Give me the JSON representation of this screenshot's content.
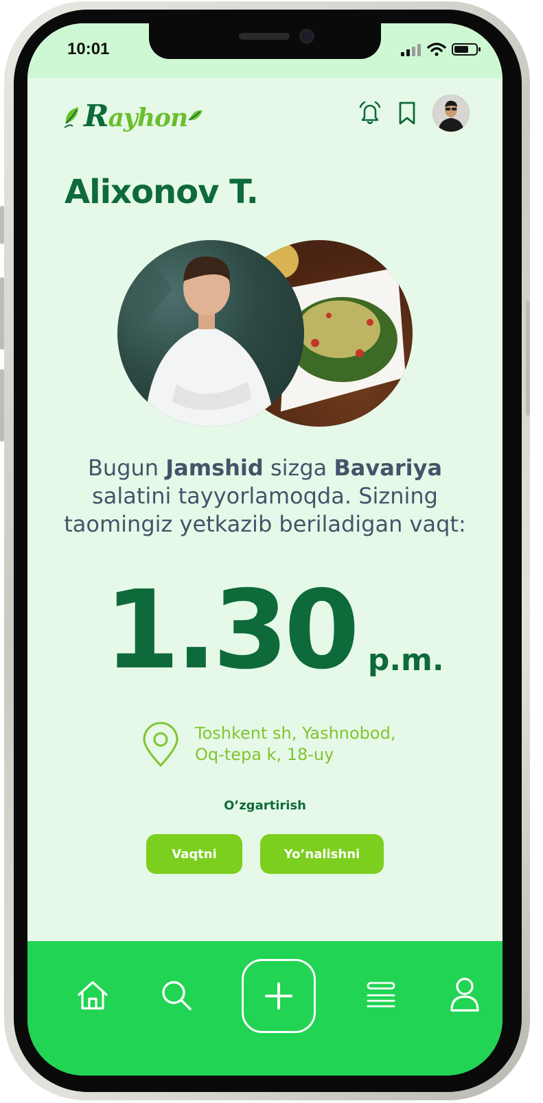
{
  "status_bar": {
    "time": "10:01"
  },
  "header": {
    "logo_text": "ayhon",
    "logo_initial": "R",
    "icons": [
      "bell-icon",
      "bookmark-icon",
      "avatar"
    ]
  },
  "page": {
    "title": "Alixonov T."
  },
  "message": {
    "part1": "Bugun ",
    "chef_name": "Jamshid",
    "part2": " sizga ",
    "dish_name": "Bavariya",
    "part3": " salatini tayyorlamoqda. Sizning taomingiz yetkazib beriladigan vaqt:"
  },
  "delivery": {
    "time": "1.30",
    "ampm": "p.m."
  },
  "address": {
    "line1": "Toshkent sh, Yashnobod,",
    "line2": "Oq-tepa k, 18-uy"
  },
  "actions": {
    "change_label": "O’zgartirish",
    "time_button": "Vaqtni",
    "direction_button": "Yo’nalishni"
  },
  "bottom_nav": {
    "items": [
      "home-icon",
      "search-icon",
      "plus-icon",
      "menu-icon",
      "user-icon"
    ]
  },
  "colors": {
    "primary_dark": "#0e6a3a",
    "accent_green": "#7dcf1f",
    "nav_green": "#22d453",
    "background": "#e6f9e8",
    "text_gray": "#45536a"
  }
}
